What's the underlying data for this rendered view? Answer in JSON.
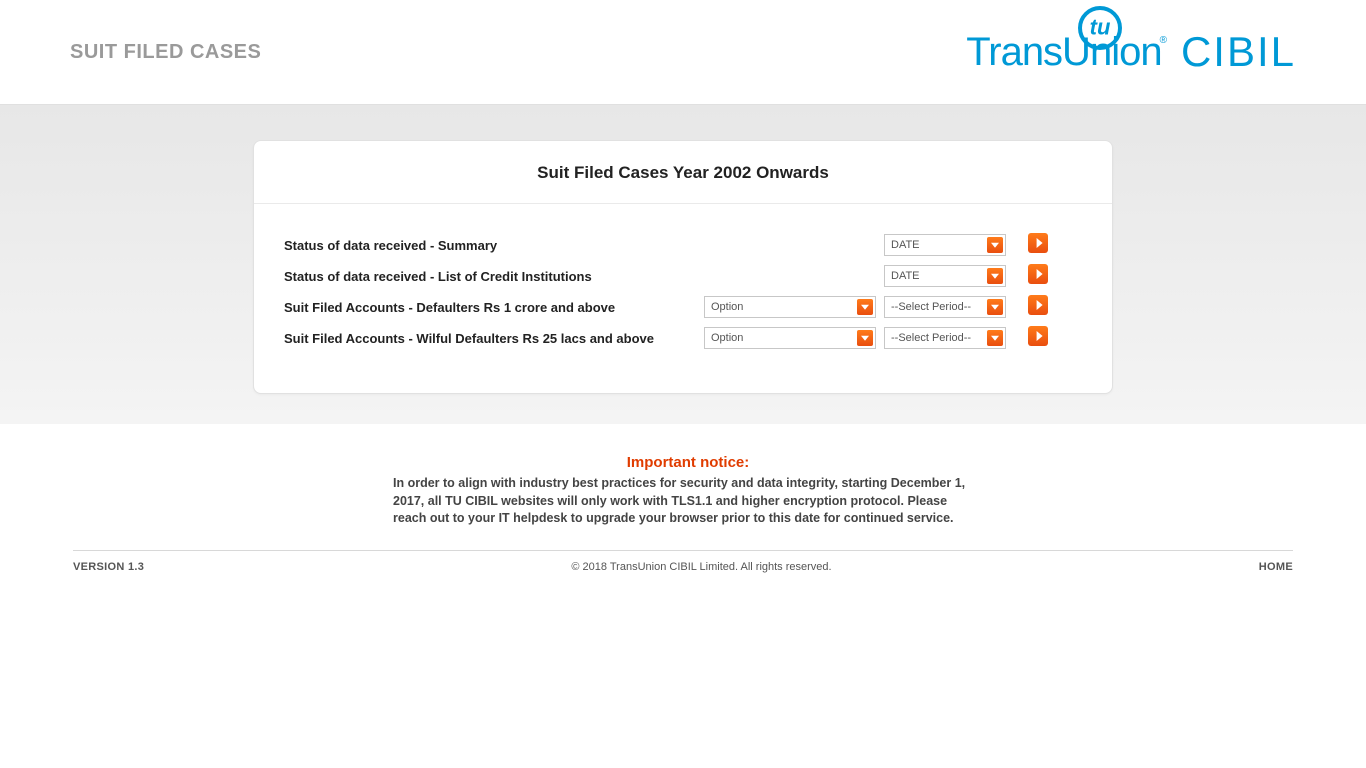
{
  "header": {
    "title": "SUIT FILED CASES",
    "logo_main": "TransUnion",
    "logo_sub": "CIBIL"
  },
  "panel": {
    "title": "Suit Filed Cases Year 2002 Onwards",
    "rows": [
      {
        "label": "Status of data received - Summary",
        "option": null,
        "period": "DATE"
      },
      {
        "label": "Status of data received - List of Credit Institutions",
        "option": null,
        "period": "DATE"
      },
      {
        "label": "Suit Filed Accounts - Defaulters Rs 1 crore and above",
        "option": "Option",
        "period": "--Select Period--"
      },
      {
        "label": "Suit Filed Accounts - Wilful Defaulters Rs 25 lacs and above",
        "option": "Option",
        "period": "--Select Period--"
      }
    ]
  },
  "notice": {
    "title": "Important notice:",
    "body": "In order to align with industry best practices for security and data integrity, starting December 1, 2017, all TU CIBIL websites will only work with TLS1.1 and higher encryption protocol. Please reach out to your IT helpdesk to upgrade your browser prior to this date for continued service."
  },
  "footer": {
    "version": "VERSION 1.3",
    "copyright": "© 2018 TransUnion CIBIL Limited. All rights reserved.",
    "home": "HOME"
  }
}
